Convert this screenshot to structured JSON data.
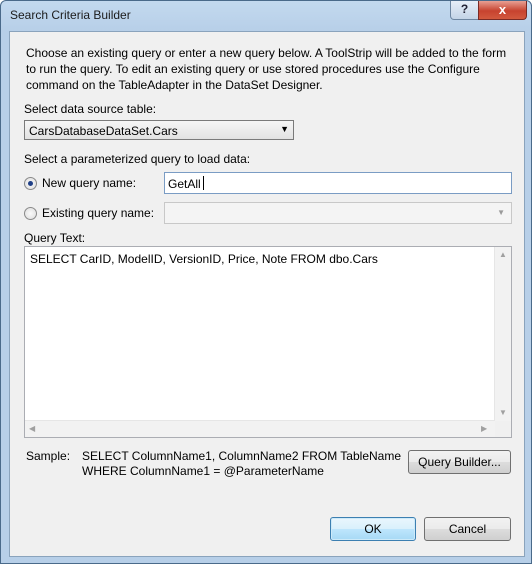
{
  "window": {
    "title": "Search Criteria Builder",
    "help_label": "?",
    "close_label": "x"
  },
  "intro": "Choose an existing query or enter a new query below. A ToolStrip will be added to the form to run the query. To edit an existing query or use stored procedures use the Configure command on the TableAdapter in the DataSet Designer.",
  "data_source": {
    "label": "Select data source table:",
    "value": "CarsDatabaseDataSet.Cars"
  },
  "param_query_label": "Select a parameterized query to load data:",
  "new_query": {
    "label": "New query name:",
    "value": "GetAll",
    "selected": true
  },
  "existing_query": {
    "label": "Existing query name:",
    "value": "",
    "selected": false
  },
  "query_text": {
    "label": "Query Text:",
    "value": "SELECT CarID, ModelID, VersionID, Price, Note FROM dbo.Cars"
  },
  "sample": {
    "label": "Sample:",
    "line1": "SELECT ColumnName1, ColumnName2 FROM TableName",
    "line2": "WHERE ColumnName1 = @ParameterName"
  },
  "buttons": {
    "query_builder": "Query Builder...",
    "ok": "OK",
    "cancel": "Cancel"
  },
  "icons": {
    "dropdown": "chevron-down-icon",
    "scroll_up": "arrow-up-icon",
    "scroll_down": "arrow-down-icon",
    "scroll_left": "arrow-left-icon",
    "scroll_right": "arrow-right-icon"
  }
}
